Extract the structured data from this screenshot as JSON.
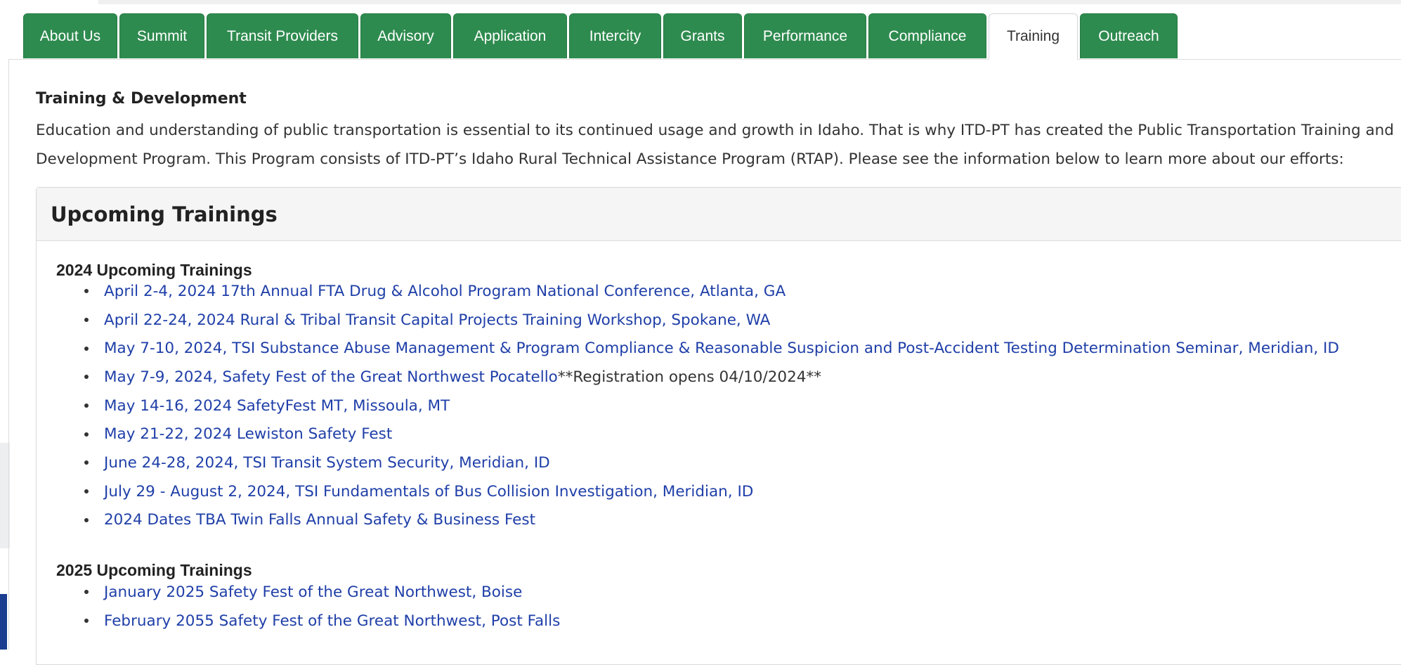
{
  "tabs": [
    {
      "label": "About Us",
      "active": false
    },
    {
      "label": "Summit",
      "active": false
    },
    {
      "label": "Transit Providers",
      "active": false
    },
    {
      "label": "Advisory",
      "active": false
    },
    {
      "label": "Application",
      "active": false
    },
    {
      "label": "Intercity",
      "active": false
    },
    {
      "label": "Grants",
      "active": false
    },
    {
      "label": "Performance",
      "active": false
    },
    {
      "label": "Compliance",
      "active": false
    },
    {
      "label": "Training",
      "active": true
    },
    {
      "label": "Outreach",
      "active": false
    }
  ],
  "section": {
    "title": "Training & Development",
    "intro": "Education and understanding of public transportation is essential to its continued usage and growth in Idaho. That is why ITD-PT has created the Public Transportation Training and Development Program. This Program consists of ITD-PT’s Idaho Rural Technical Assistance Program (RTAP). Please see the information below to learn more about our efforts:"
  },
  "panel": {
    "title": "Upcoming Trainings",
    "groups": [
      {
        "heading": "2024 Upcoming Trainings",
        "items": [
          {
            "link": "April 2-4, 2024 17th Annual FTA Drug & Alcohol Program National Conference, Atlanta, GA",
            "note": ""
          },
          {
            "link": "April 22-24, 2024 Rural & Tribal Transit Capital Projects Training Workshop, Spokane, WA",
            "note": ""
          },
          {
            "link": "May 7-10, 2024, TSI Substance Abuse Management & Program Compliance & Reasonable Suspicion and Post-Accident Testing Determination Seminar, Meridian, ID",
            "note": ""
          },
          {
            "link": "May 7-9, 2024, Safety Fest of the Great Northwest Pocatello",
            "note": " **Registration opens 04/10/2024**"
          },
          {
            "link": "May 14-16, 2024 SafetyFest MT, Missoula, MT",
            "note": ""
          },
          {
            "link": "May 21-22, 2024 Lewiston Safety Fest",
            "note": ""
          },
          {
            "link": "June 24-28, 2024, TSI Transit System Security, Meridian, ID",
            "note": ""
          },
          {
            "link": "July 29 - August 2, 2024, TSI Fundamentals of Bus Collision Investigation, Meridian, ID",
            "note": ""
          },
          {
            "link": "2024 Dates TBA Twin Falls Annual Safety & Business Fest",
            "note": ""
          }
        ]
      },
      {
        "heading": "2025 Upcoming Trainings",
        "items": [
          {
            "link": "January 2025 Safety Fest of the Great Northwest, Boise",
            "note": ""
          },
          {
            "link": "February 2055 Safety Fest of the Great Northwest, Post Falls",
            "note": ""
          }
        ]
      }
    ]
  }
}
